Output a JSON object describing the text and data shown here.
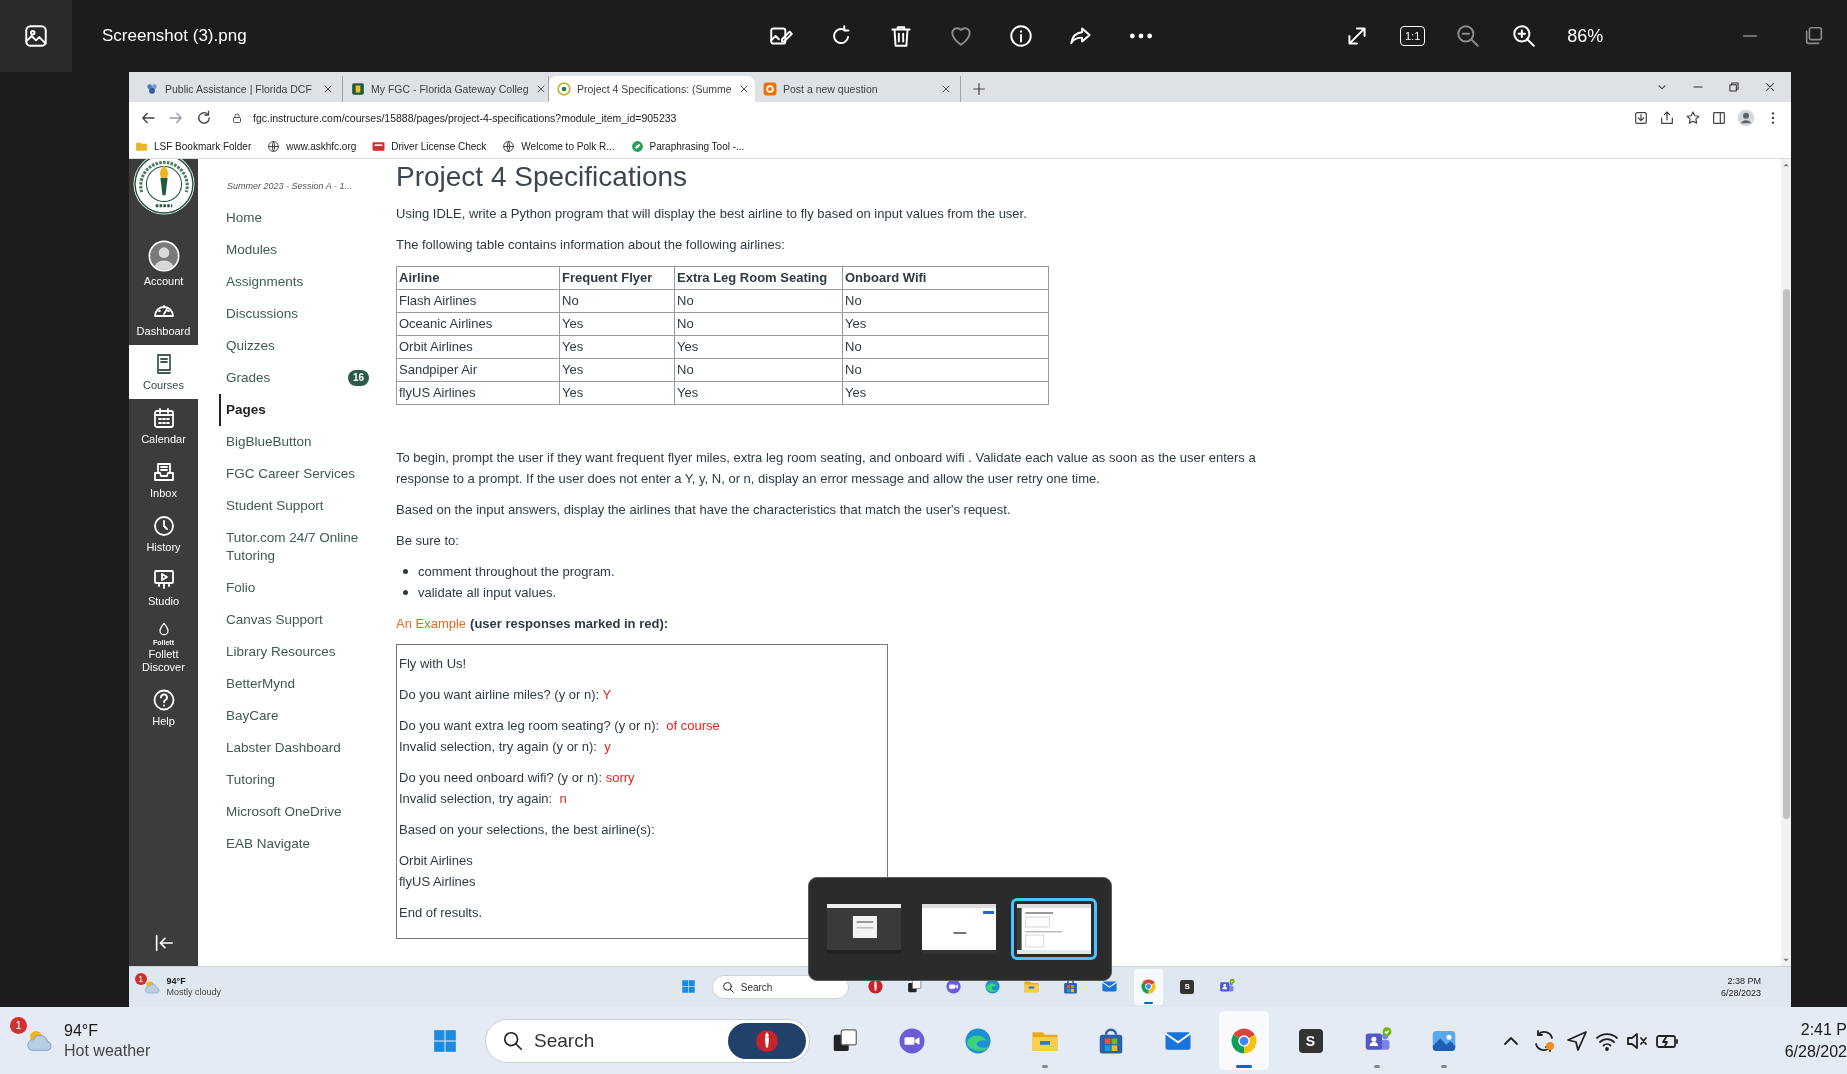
{
  "viewer": {
    "file_name": "Screenshot (3).png",
    "actual_size_label": "1:1",
    "zoom": "86%"
  },
  "browser": {
    "tabs": [
      {
        "title": "Public Assistance | Florida DCF",
        "kind": "dcf",
        "selected": false
      },
      {
        "title": "My FGC - Florida Gateway Colleg",
        "kind": "fgc",
        "selected": false
      },
      {
        "title": "Project 4 Specifications: (Summe",
        "kind": "canvas",
        "selected": true
      },
      {
        "title": "Post a new question",
        "kind": "chegg",
        "selected": false
      }
    ],
    "url": "fgc.instructure.com/courses/15888/pages/project-4-specifications?module_item_id=905233",
    "bookmarks": [
      {
        "label": "LSF Bookmark Folder",
        "kind": "folder"
      },
      {
        "label": "www.askhfc.org",
        "kind": "globe"
      },
      {
        "label": "Driver License Check",
        "kind": "license"
      },
      {
        "label": "Welcome to Polk R...",
        "kind": "globe"
      },
      {
        "label": "Paraphrasing Tool -...",
        "kind": "leaf"
      }
    ]
  },
  "global_nav": {
    "items": [
      {
        "label": "Account",
        "kind": "account",
        "selected": false
      },
      {
        "label": "Dashboard",
        "kind": "dashboard",
        "selected": false
      },
      {
        "label": "Courses",
        "kind": "courses",
        "selected": true
      },
      {
        "label": "Calendar",
        "kind": "calendar",
        "selected": false
      },
      {
        "label": "Inbox",
        "kind": "inbox",
        "selected": false
      },
      {
        "label": "History",
        "kind": "history",
        "selected": false
      },
      {
        "label": "Studio",
        "kind": "studio",
        "selected": false
      },
      {
        "label": "Follett Discover",
        "kind": "follett",
        "logo_text": "Follett",
        "selected": false
      },
      {
        "label": "Help",
        "kind": "help",
        "selected": false
      }
    ]
  },
  "course_nav": {
    "term": "Summer 2023 - Session A - 1...",
    "items": [
      {
        "label": "Home",
        "selected": false
      },
      {
        "label": "Modules",
        "selected": false
      },
      {
        "label": "Assignments",
        "selected": false
      },
      {
        "label": "Discussions",
        "selected": false
      },
      {
        "label": "Quizzes",
        "selected": false
      },
      {
        "label": "Grades",
        "selected": false,
        "badge": "16"
      },
      {
        "label": "Pages",
        "selected": true
      },
      {
        "label": "BigBlueButton",
        "selected": false
      },
      {
        "label": "FGC Career Services",
        "selected": false
      },
      {
        "label": "Student Support",
        "selected": false
      },
      {
        "label": "Tutor.com 24/7 Online Tutoring",
        "selected": false
      },
      {
        "label": "Folio",
        "selected": false
      },
      {
        "label": "Canvas Support",
        "selected": false
      },
      {
        "label": "Library Resources",
        "selected": false
      },
      {
        "label": "BetterMynd",
        "selected": false
      },
      {
        "label": "BayCare",
        "selected": false
      },
      {
        "label": "Labster Dashboard",
        "selected": false
      },
      {
        "label": "Tutoring",
        "selected": false
      },
      {
        "label": "Microsoft OneDrive",
        "selected": false
      },
      {
        "label": "EAB Navigate",
        "selected": false
      }
    ]
  },
  "page": {
    "title": "Project 4 Specifications",
    "intro": [
      "Using IDLE, write a Python program that will display the best airline to fly based on input values from the user.",
      "The following table contains information about the following airlines:"
    ],
    "table": {
      "columns": [
        "Airline",
        "Frequent Flyer",
        "Extra Leg Room Seating",
        "Onboard Wifi"
      ],
      "rows": [
        [
          "Flash Airlines",
          "No",
          "No",
          "No"
        ],
        [
          "Oceanic Airlines",
          "Yes",
          "No",
          "Yes"
        ],
        [
          "Orbit Airlines",
          "Yes",
          "Yes",
          "No"
        ],
        [
          "Sandpiper Air",
          "Yes",
          "No",
          "No"
        ],
        [
          "flyUS Airlines",
          "Yes",
          "Yes",
          "Yes"
        ]
      ]
    },
    "paragraphs": [
      "To begin, prompt the user if they want frequent flyer miles, extra leg room seating, and onboard wifi .  Validate each value as soon as the user enters a response to a prompt.  If the user does not enter a Y, y, N, or n, display an error message and allow the user retry one time.",
      "Based on the input answers, display the airlines that have the characteristics that match the user's request.",
      "Be sure to:"
    ],
    "bullets": [
      "comment throughout the program.",
      "validate all input values."
    ],
    "example": {
      "title": "An Example",
      "note": "(user responses marked in red):",
      "blocks": [
        {
          "lines": [
            {
              "text": "Fly with Us!"
            }
          ]
        },
        {
          "lines": [
            {
              "text": "Do you want airline miles? (y or n): ",
              "response": "Y"
            }
          ]
        },
        {
          "lines": [
            {
              "text": "Do you want extra leg room seating? (y or n):  ",
              "response": "of course"
            },
            {
              "text": "Invalid selection, try again (y or n):  ",
              "response": "y"
            }
          ]
        },
        {
          "lines": [
            {
              "text": "Do you need onboard wifi? (y or n): ",
              "response": "sorry"
            },
            {
              "text": "Invalid selection, try again:  ",
              "response": "n"
            }
          ]
        },
        {
          "lines": [
            {
              "text": "Based on your selections, the best airline(s):"
            }
          ]
        },
        {
          "lines": [
            {
              "text": "Orbit Airlines"
            },
            {
              "text": "flyUS Airlines"
            }
          ]
        },
        {
          "lines": [
            {
              "text": "End of results."
            }
          ]
        }
      ]
    }
  },
  "inner_taskbar": {
    "weather": {
      "alerts": "1",
      "temperature": "94°F",
      "condition": "Mostly cloudy"
    },
    "search_placeholder": "Search",
    "apps": [
      {
        "kind": "lsf",
        "pinned_in_search": false
      },
      {
        "kind": "task-view",
        "open": false,
        "active": false
      },
      {
        "kind": "meet",
        "open": false,
        "active": false
      },
      {
        "kind": "edge",
        "open": false,
        "active": false
      },
      {
        "kind": "explorer",
        "open": false,
        "active": false
      },
      {
        "kind": "store",
        "open": false,
        "active": false
      },
      {
        "kind": "mail",
        "open": false,
        "active": false
      },
      {
        "kind": "chrome",
        "open": true,
        "active": true
      },
      {
        "kind": "s",
        "label": "S",
        "open": false,
        "active": false
      },
      {
        "kind": "teams",
        "open": false,
        "active": false
      }
    ],
    "time": "2:38 PM",
    "date": "6/28/2023"
  },
  "task_switcher": {
    "windows": [
      {
        "selected": false
      },
      {
        "selected": false
      },
      {
        "selected": true
      }
    ]
  },
  "taskbar": {
    "weather": {
      "alerts": "1",
      "temperature": "94°F",
      "condition": "Hot weather"
    },
    "search_placeholder": "Search",
    "apps": [
      {
        "kind": "lsf",
        "pinned_in_search": true
      },
      {
        "kind": "task-view",
        "open": false,
        "active": false
      },
      {
        "kind": "meet",
        "open": false,
        "active": false
      },
      {
        "kind": "edge",
        "open": false,
        "active": false
      },
      {
        "kind": "explorer",
        "open": true,
        "active": false
      },
      {
        "kind": "store",
        "open": false,
        "active": false
      },
      {
        "kind": "mail",
        "open": false,
        "active": false
      },
      {
        "kind": "chrome",
        "open": true,
        "active": true
      },
      {
        "kind": "s",
        "label": "S",
        "open": false,
        "active": false
      },
      {
        "kind": "teams",
        "open": true,
        "active": false
      },
      {
        "kind": "photos",
        "open": true,
        "active": false
      }
    ],
    "time": "2:41 P",
    "date": "6/28/202"
  }
}
